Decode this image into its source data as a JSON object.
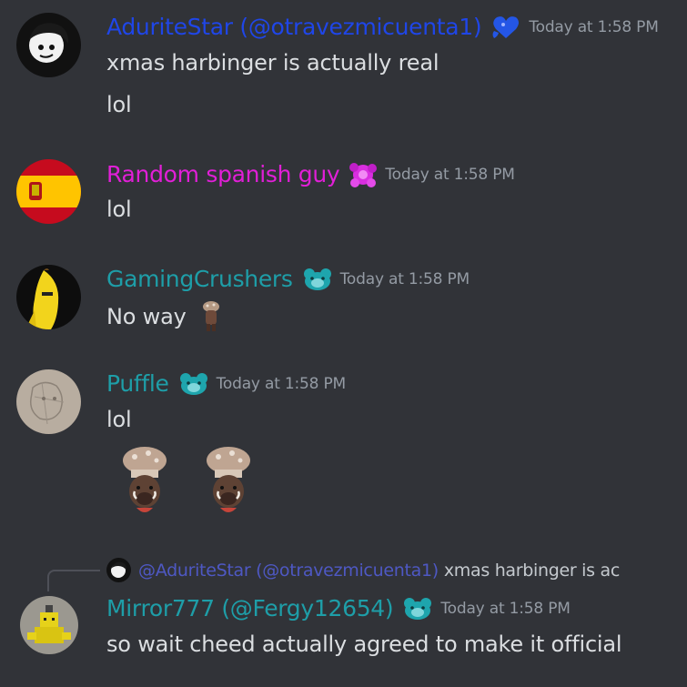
{
  "colors": {
    "background": "#313338",
    "message_text": "#dbdee1",
    "timestamp": "#949ba4",
    "name_adurite": "#1f46e8",
    "name_spanish": "#e11fd7",
    "name_teal": "#1e9ea8",
    "mention": "#5865f2"
  },
  "messages": [
    {
      "username": "AduriteStar (@otravezmicuenta1)",
      "badge_icon": "blue-heart-badge-icon",
      "timestamp": "Today at 1:58 PM",
      "lines": [
        "xmas harbinger is actually real",
        "lol"
      ]
    },
    {
      "username": "Random spanish guy",
      "badge_icon": "pink-splat-badge-icon",
      "timestamp": "Today at 1:58 PM",
      "lines": [
        "lol"
      ]
    },
    {
      "username": "GamingCrushers",
      "badge_icon": "teal-bear-badge-icon",
      "timestamp": "Today at 1:58 PM",
      "lines": [
        "No way"
      ],
      "inline_emoji_icon": "mushroom-figure-emoji-icon"
    },
    {
      "username": "Puffle",
      "badge_icon": "teal-bear-badge-icon",
      "timestamp": "Today at 1:58 PM",
      "lines": [
        "lol"
      ],
      "big_emoji_icons": [
        "boar-mushroom-emoji-icon",
        "boar-mushroom-emoji-icon"
      ]
    },
    {
      "username": "Mirror777 (@Fergy12654)",
      "badge_icon": "teal-bear-badge-icon",
      "timestamp": "Today at 1:58 PM",
      "lines": [
        "so wait cheed actually agreed to make it official"
      ],
      "reply": {
        "mention": "@AduriteStar (@otravezmicuenta1)",
        "text": "xmas harbinger is ac"
      }
    }
  ]
}
